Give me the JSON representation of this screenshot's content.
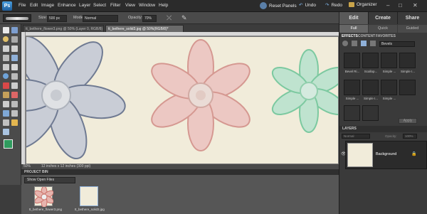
{
  "app": {
    "logo_text": "Ps"
  },
  "menu": [
    "File",
    "Edit",
    "Image",
    "Enhance",
    "Layer",
    "Select",
    "Filter",
    "View",
    "Window",
    "Help"
  ],
  "top_actions": {
    "reset_panels": "Reset Panels",
    "undo": "Undo",
    "redo": "Redo",
    "organizer": "Organizer"
  },
  "mode_tabs": [
    "Edit",
    "Create",
    "Share"
  ],
  "edit_subtabs": [
    "Full",
    "Quick",
    "Guided"
  ],
  "options": {
    "size_label": "Size:",
    "size_value": "500 px",
    "mode_label": "Mode:",
    "mode_value": "Normal",
    "opacity_label": "Opacity:",
    "opacity_value": "70%"
  },
  "documents": [
    {
      "label": "tt_bethere_flower3.png @ 50% (Layer 0, RGB/8)",
      "active": false
    },
    {
      "label": "tt_bethere_solid3.jpg @ 50%(RGB/8)*",
      "active": true
    }
  ],
  "status": {
    "zoom": "50%",
    "info": "12 inches x 12 inches (300 ppi)"
  },
  "project_bin": {
    "title": "PROJECT BIN",
    "filter": "Show Open Files",
    "items": [
      {
        "label": "tt_bethere_flower3.png"
      },
      {
        "label": "tt_bethere_solid3.jpg"
      }
    ]
  },
  "panels": {
    "tabs": [
      "EFFECTS",
      "CONTENT",
      "FAVORITES"
    ],
    "effects_dropdown": "Bevels",
    "effects": [
      "Bevel Ri...",
      "Scallop...",
      "Simple ...",
      "Simple I...",
      "Simple ...",
      "Simple I...",
      "Simple ...",
      "",
      ""
    ],
    "apply": "Apply"
  },
  "layers": {
    "title": "LAYERS",
    "blend": "Normal",
    "opacity_label": "Opacity:",
    "opacity_value": "100%",
    "items": [
      {
        "name": "Background",
        "locked": true
      }
    ]
  },
  "colors": {
    "foreground": "#2f9b5e",
    "background": "#c0392b",
    "paper": "#f1ecda"
  }
}
